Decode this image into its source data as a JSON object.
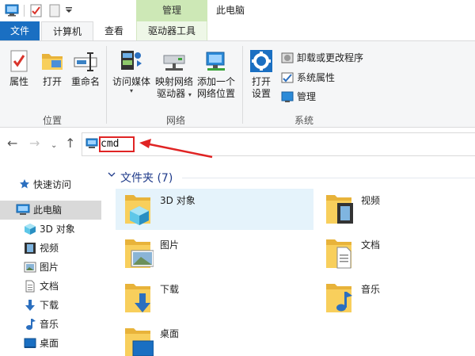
{
  "titlebar": {
    "contextual_tab": "管理",
    "window_title": "此电脑"
  },
  "tabs": {
    "file": "文件",
    "computer": "计算机",
    "view": "查看",
    "drive_tools": "驱动器工具"
  },
  "ribbon": {
    "location": {
      "label": "位置",
      "properties": "属性",
      "open": "打开",
      "rename": "重命名"
    },
    "network": {
      "label": "网络",
      "access_media_line1": "访问媒体",
      "map_drive_line1": "映射网络",
      "map_drive_line2": "驱动器",
      "add_location_line1": "添加一个",
      "add_location_line2": "网络位置"
    },
    "system": {
      "label": "系统",
      "open_settings_line1": "打开",
      "open_settings_line2": "设置",
      "uninstall": "卸载或更改程序",
      "system_properties": "系统属性",
      "manage": "管理"
    }
  },
  "address": {
    "value": "cmd"
  },
  "sidebar": {
    "items": [
      {
        "label": "快速访问",
        "icon": "star-icon"
      },
      {
        "label": "此电脑",
        "icon": "computer-icon"
      },
      {
        "label": "3D 对象",
        "icon": "cube-icon"
      },
      {
        "label": "视频",
        "icon": "video-icon"
      },
      {
        "label": "图片",
        "icon": "picture-icon"
      },
      {
        "label": "文档",
        "icon": "document-icon"
      },
      {
        "label": "下载",
        "icon": "download-icon"
      },
      {
        "label": "音乐",
        "icon": "music-icon"
      },
      {
        "label": "桌面",
        "icon": "desktop-icon"
      }
    ]
  },
  "content": {
    "section_title": "文件夹 (7)",
    "folders": [
      {
        "label": "3D 对象"
      },
      {
        "label": "视频"
      },
      {
        "label": "图片"
      },
      {
        "label": "文档"
      },
      {
        "label": "下载"
      },
      {
        "label": "音乐"
      },
      {
        "label": "桌面"
      }
    ]
  },
  "colors": {
    "file_tab": "#1a6fc2",
    "contextual_tab": "#cde8b6",
    "annotation": "#e02424",
    "folder": "#f5c24c",
    "selection": "#e5f3fb"
  }
}
